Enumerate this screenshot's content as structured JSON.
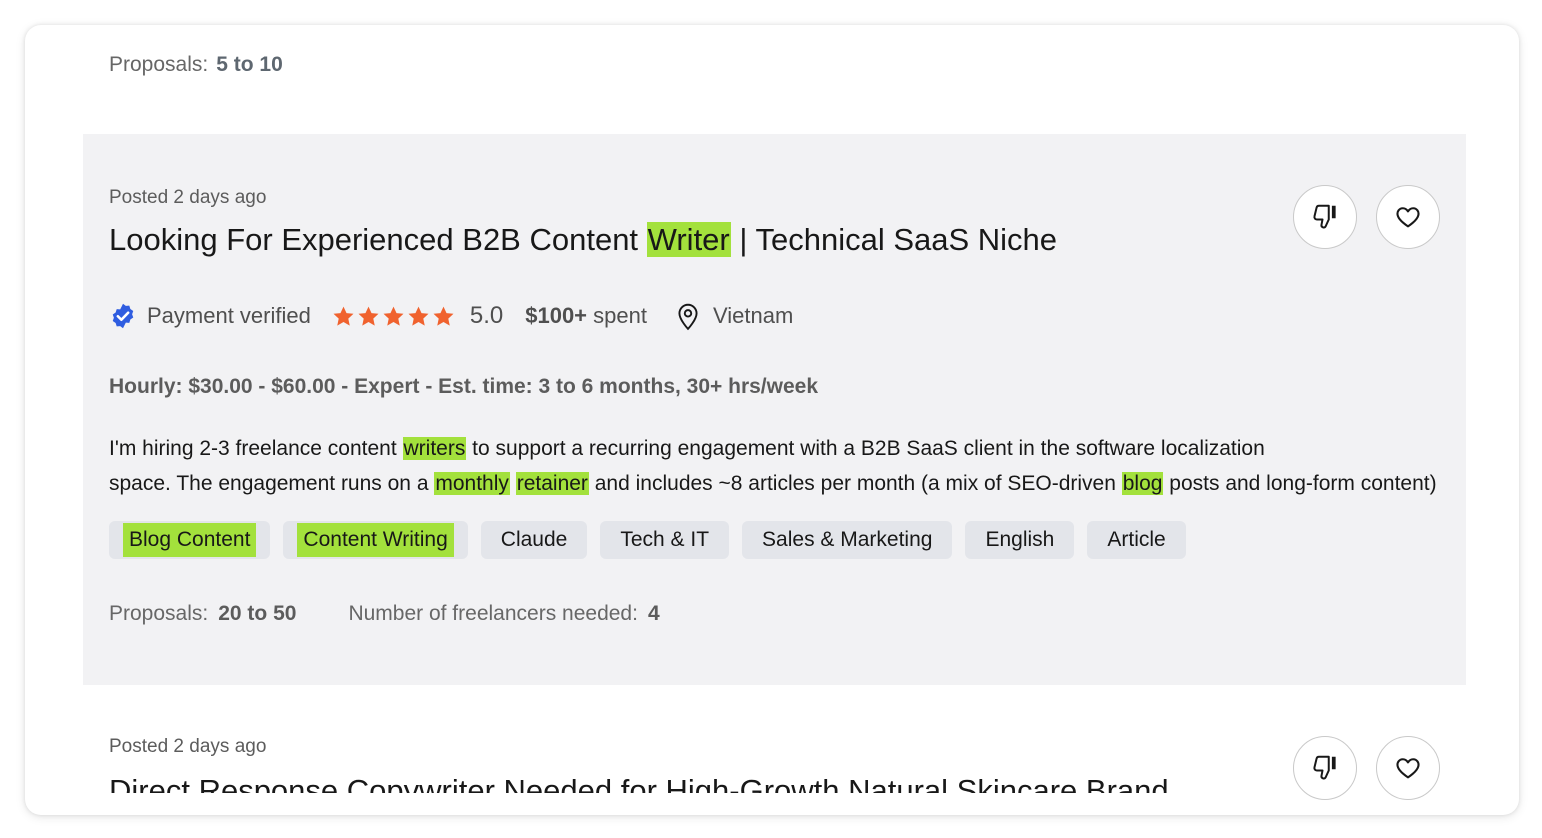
{
  "previous": {
    "proposals_label": "Proposals:",
    "proposals_value": "5 to 10"
  },
  "job": {
    "posted": "Posted 2 days ago",
    "title_parts": [
      "Looking For Experienced B2B Content ",
      "Writer",
      " | Technical SaaS Niche"
    ],
    "payment_verified": "Payment verified",
    "rating": "5.0",
    "rating_stars": 5,
    "spent_amount": "$100+",
    "spent_label": " spent",
    "location": "Vietnam",
    "terms": "Hourly: $30.00 - $60.00 - Expert - Est. time: 3 to 6 months, 30+ hrs/week",
    "description_line1": [
      "I'm hiring 2-3 freelance content ",
      "writers",
      " to support a recurring engagement with a B2B SaaS client in the software localization"
    ],
    "description_line2": [
      "space. The engagement runs on a ",
      "monthly",
      " ",
      "retainer",
      " and includes ~8 articles per month (a mix of SEO-driven ",
      "blog",
      " posts and long-form content)"
    ],
    "tags": [
      "Blog Content",
      "Content Writing",
      "Claude",
      "Tech & IT",
      "Sales & Marketing",
      "English",
      "Article"
    ],
    "proposals_label": "Proposals:",
    "proposals_value": "20 to 50",
    "freelancers_label": "Number of freelancers needed:",
    "freelancers_value": "4"
  },
  "next_job": {
    "posted": "Posted 2 days ago",
    "title": "Direct Response Copywriter Needed for High-Growth Natural Skincare Brand"
  },
  "colors": {
    "highlight": "#a3e13c",
    "star": "#f0622e",
    "verified": "#2f5de0",
    "card_bg": "#f2f2f4",
    "tag_bg": "#e3e5ea"
  },
  "icons": {
    "dislike": "thumbs-down-icon",
    "save": "heart-icon",
    "verified": "verified-badge-icon",
    "star": "star-icon",
    "location": "location-pin-icon"
  }
}
